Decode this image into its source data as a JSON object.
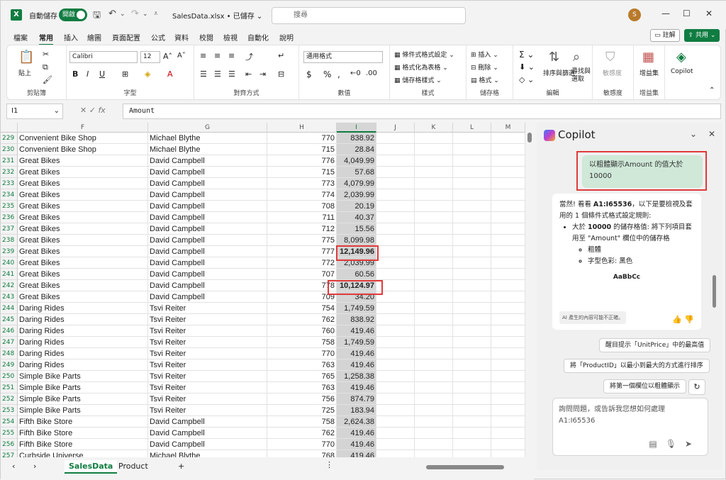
{
  "titlebar": {
    "autosave_label": "自動儲存",
    "toggle_label": "開啟",
    "filename": "SalesData.xlsx • 已儲存 ⌄",
    "search_placeholder": "搜尋",
    "avatar_letter": "S"
  },
  "tabs": [
    "檔案",
    "常用",
    "插入",
    "繪圖",
    "頁面配置",
    "公式",
    "資料",
    "校閱",
    "檢視",
    "自動化",
    "說明"
  ],
  "tab_comment": "註解",
  "tab_share": "共用",
  "ribbon": {
    "clipboard": {
      "paste": "貼上",
      "label": "剪貼簿"
    },
    "font": {
      "name": "Calibri",
      "size": "12",
      "label": "字型",
      "bold": "B",
      "italic": "I",
      "underline": "U"
    },
    "align": {
      "label": "對齊方式"
    },
    "number": {
      "format": "通用格式",
      "label": "數值"
    },
    "styles": {
      "cond": "條件式格式設定",
      "table": "格式化為表格",
      "cell": "儲存格樣式",
      "label": "樣式"
    },
    "cells": {
      "insert": "插入",
      "delete": "刪除",
      "format": "格式",
      "label": "儲存格"
    },
    "editing": {
      "sort": "排序與篩選",
      "find": "尋找與選取",
      "label": "編輯"
    },
    "sensitivity": {
      "btn": "敏感度",
      "label": "敏感度"
    },
    "addins": {
      "btn": "增益集",
      "label": "增益集"
    },
    "copilot": {
      "btn": "Copilot"
    }
  },
  "formula_bar": {
    "namebox": "I1",
    "formula": "Amount"
  },
  "columns": [
    "F",
    "G",
    "H",
    "I",
    "J",
    "K",
    "L",
    "M"
  ],
  "rows": [
    [
      "229",
      "Convenient Bike Shop",
      "Michael Blythe",
      "770",
      "838.92"
    ],
    [
      "230",
      "Convenient Bike Shop",
      "Michael Blythe",
      "715",
      "28.84"
    ],
    [
      "231",
      "Great Bikes",
      "David Campbell",
      "776",
      "4,049.99"
    ],
    [
      "232",
      "Great Bikes",
      "David Campbell",
      "715",
      "57.68"
    ],
    [
      "233",
      "Great Bikes",
      "David Campbell",
      "773",
      "4,079.99"
    ],
    [
      "234",
      "Great Bikes",
      "David Campbell",
      "774",
      "2,039.99"
    ],
    [
      "235",
      "Great Bikes",
      "David Campbell",
      "708",
      "20.19"
    ],
    [
      "236",
      "Great Bikes",
      "David Campbell",
      "711",
      "40.37"
    ],
    [
      "237",
      "Great Bikes",
      "David Campbell",
      "712",
      "15.56"
    ],
    [
      "238",
      "Great Bikes",
      "David Campbell",
      "775",
      "8,099.98"
    ],
    [
      "239",
      "Great Bikes",
      "David Campbell",
      "777",
      "12,149.96"
    ],
    [
      "240",
      "Great Bikes",
      "David Campbell",
      "772",
      "2,039.99"
    ],
    [
      "241",
      "Great Bikes",
      "David Campbell",
      "707",
      "60.56"
    ],
    [
      "242",
      "Great Bikes",
      "David Campbell",
      "778",
      "10,124.97"
    ],
    [
      "243",
      "Great Bikes",
      "David Campbell",
      "709",
      "34.20"
    ],
    [
      "244",
      "Daring Rides",
      "Tsvi Reiter",
      "754",
      "1,749.59"
    ],
    [
      "245",
      "Daring Rides",
      "Tsvi Reiter",
      "762",
      "838.92"
    ],
    [
      "246",
      "Daring Rides",
      "Tsvi Reiter",
      "760",
      "419.46"
    ],
    [
      "247",
      "Daring Rides",
      "Tsvi Reiter",
      "758",
      "1,749.59"
    ],
    [
      "248",
      "Daring Rides",
      "Tsvi Reiter",
      "770",
      "419.46"
    ],
    [
      "249",
      "Daring Rides",
      "Tsvi Reiter",
      "763",
      "419.46"
    ],
    [
      "250",
      "Simple Bike Parts",
      "Tsvi Reiter",
      "765",
      "1,258.38"
    ],
    [
      "251",
      "Simple Bike Parts",
      "Tsvi Reiter",
      "763",
      "419.46"
    ],
    [
      "252",
      "Simple Bike Parts",
      "Tsvi Reiter",
      "756",
      "874.79"
    ],
    [
      "253",
      "Simple Bike Parts",
      "Tsvi Reiter",
      "725",
      "183.94"
    ],
    [
      "254",
      "Fifth Bike Store",
      "David Campbell",
      "758",
      "2,624.38"
    ],
    [
      "255",
      "Fifth Bike Store",
      "David Campbell",
      "762",
      "419.46"
    ],
    [
      "256",
      "Fifth Bike Store",
      "David Campbell",
      "770",
      "419.46"
    ],
    [
      "257",
      "Curbside Universe",
      "Michael Blythe",
      "768",
      "419.46"
    ]
  ],
  "bold_rows": [
    "239",
    "242"
  ],
  "sheets": [
    "SalesData",
    "Product",
    "+"
  ],
  "copilot": {
    "title": "Copilot",
    "user_message": "以粗體顯示Amount 的值大於 10000",
    "reply_intro_1": "當然! 看看 ",
    "reply_range": "A1:I65536",
    "reply_intro_2": "，以下是要檢視及套用的 1 個條件式格式設定規則:",
    "rule_1": "大於 ",
    "rule_value": "10000",
    "rule_2": " 的儲存格值: 將下列項目套用至 \"Amount\" 欄位中的儲存格",
    "sub_1": "粗體",
    "sub_2": "字型色彩: 黑色",
    "sample": "AaBbCc",
    "disclaimer": "AI 產生的內容可能不正確。",
    "sugg_1": "醒目提示「UnitPrice」中的最高值",
    "sugg_2": "將「ProductID」以最小到最大的方式進行排序",
    "sugg_3": "將第一個欄位以粗體顯示",
    "ask_placeholder": "詢問問題，或告訴我您想如何處理 A1:I65536"
  }
}
